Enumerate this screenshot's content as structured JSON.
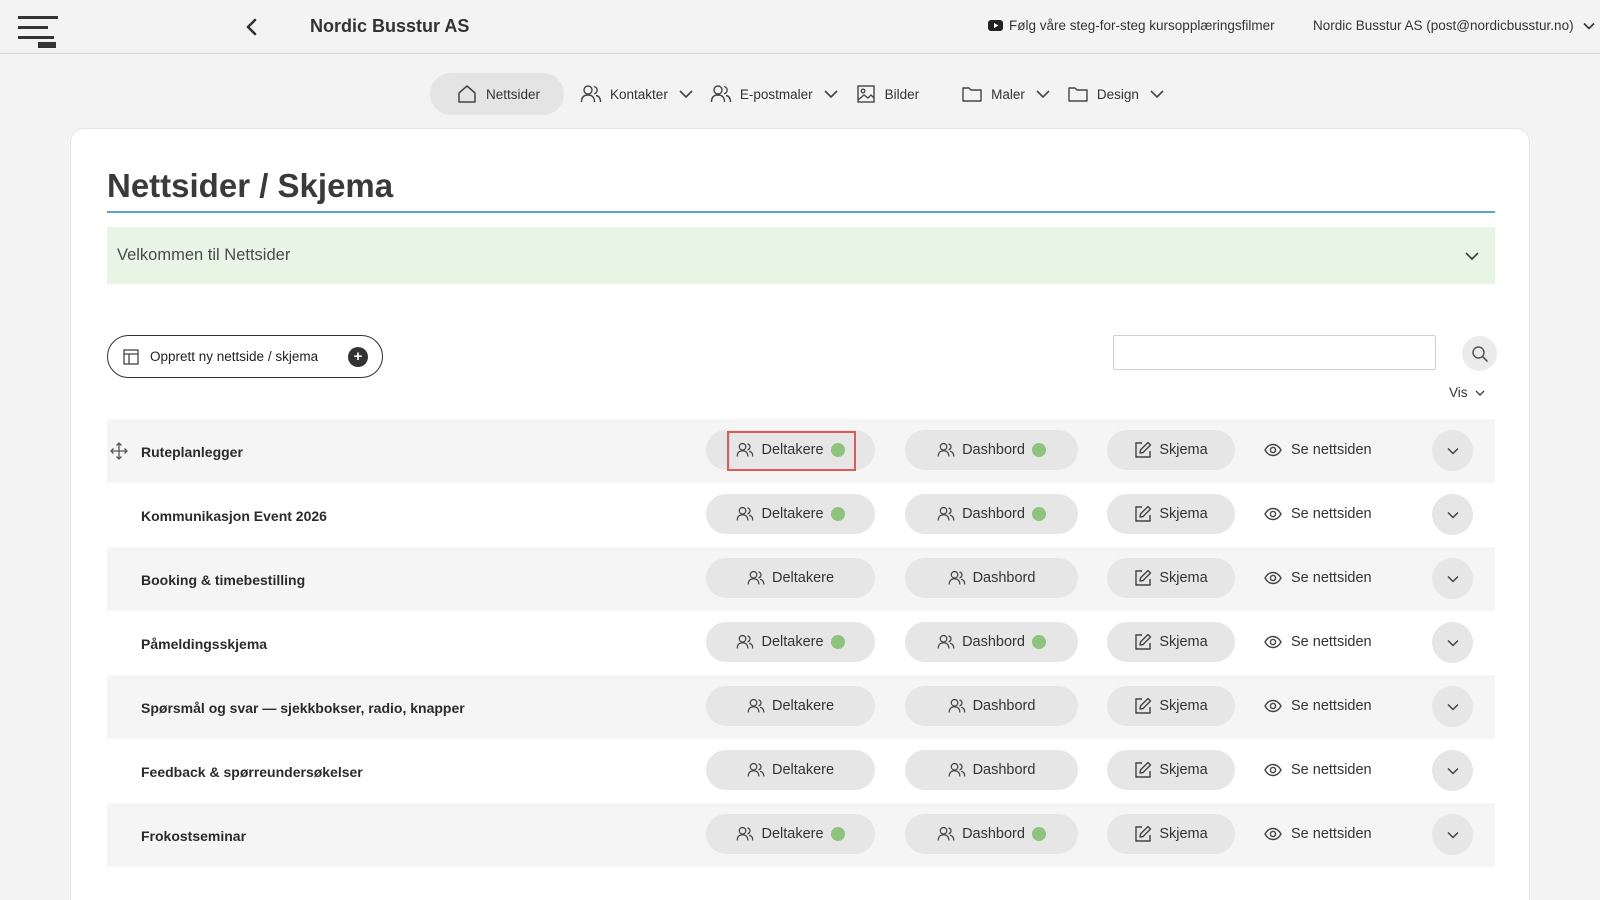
{
  "header": {
    "title": "Nordic Busstur AS",
    "video_link": "Følg våre steg-for-steg kursopplæringsfilmer",
    "account": "Nordic Busstur AS (post@nordicbusstur.no)"
  },
  "nav": {
    "items": [
      {
        "label": "Nettsider",
        "icon": "home-icon",
        "active": true
      },
      {
        "label": "Kontakter",
        "icon": "users-icon",
        "dropdown": true
      },
      {
        "label": "E-postmaler",
        "icon": "users-icon",
        "dropdown": true
      },
      {
        "label": "Bilder",
        "icon": "image-icon"
      },
      {
        "label": "Maler",
        "icon": "folder-icon",
        "dropdown": true
      },
      {
        "label": "Design",
        "icon": "folder-icon",
        "dropdown": true
      }
    ]
  },
  "page": {
    "title": "Nettsider / Skjema",
    "welcome": "Velkommen til Nettsider",
    "create_button": "Opprett ny nettside / skjema",
    "search_value": "",
    "view_label": "Vis"
  },
  "row_actions": {
    "participants": "Deltakere",
    "dashboard": "Dashbord",
    "form": "Skjema",
    "view_site": "Se nettsiden"
  },
  "colors": {
    "status_dot": "#8bc47a",
    "title_underline": "#5aa4d0",
    "welcome_bg": "#e8f5e5",
    "highlight": "#e05858"
  },
  "rows": [
    {
      "name": "Ruteplanlegger",
      "participants_active": true,
      "dashboard_active": true,
      "draggable": true
    },
    {
      "name": "Kommunikasjon Event 2026",
      "participants_active": true,
      "dashboard_active": true
    },
    {
      "name": "Booking & timebestilling",
      "participants_active": false,
      "dashboard_active": false
    },
    {
      "name": "Påmeldingsskjema",
      "participants_active": true,
      "dashboard_active": true
    },
    {
      "name": "Spørsmål og svar — sjekkbokser, radio, knapper",
      "participants_active": false,
      "dashboard_active": false
    },
    {
      "name": "Feedback & spørreundersøkelser",
      "participants_active": false,
      "dashboard_active": false
    },
    {
      "name": "Frokostseminar",
      "participants_active": true,
      "dashboard_active": true
    }
  ]
}
